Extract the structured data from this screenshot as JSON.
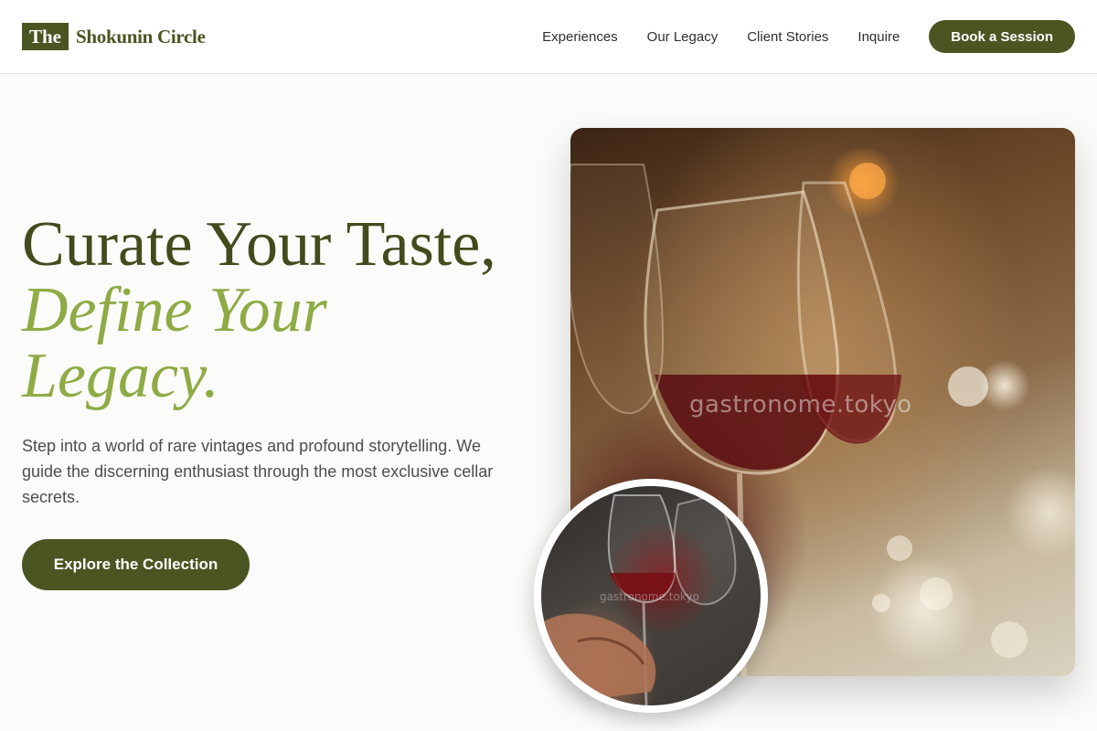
{
  "header": {
    "logo_box": "The",
    "logo_text": "Shokunin Circle",
    "nav": [
      "Experiences",
      "Our Legacy",
      "Client Stories",
      "Inquire"
    ],
    "cta_label": "Book a Session"
  },
  "hero": {
    "title_line1": "Curate Your Taste,",
    "title_line2": "Define Your",
    "title_line3": "Legacy.",
    "description": "Step into a world of rare vintages and profound storytelling. We guide the discerning enthusiast through the most exclusive cellar secrets.",
    "cta_label": "Explore the Collection",
    "image_watermark": "gastronome.tokyo",
    "circle_watermark": "gastronome.tokyo"
  },
  "colors": {
    "brand": "#4a5522",
    "accent": "#8eab45",
    "title": "#424b1c",
    "background": "#fbfbf9"
  }
}
